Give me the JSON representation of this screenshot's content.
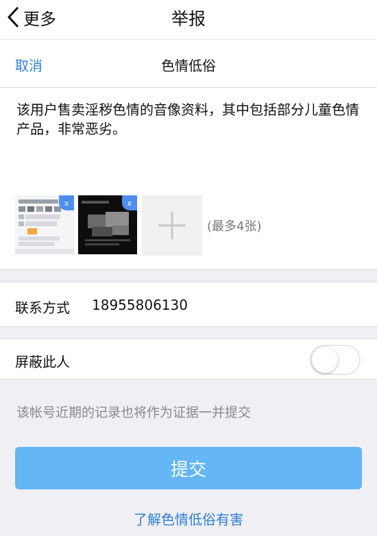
{
  "nav": {
    "back_label": "更多",
    "title": "举报"
  },
  "subbar": {
    "cancel_label": "取消",
    "category": "色情低俗"
  },
  "report": {
    "description": "该用户售卖淫秽色情的音像资料，其中包括部分儿童色情产品，非常恶劣。",
    "attachments": [
      {
        "icon": "screenshot-thumbnail-chat",
        "remove_label": "x"
      },
      {
        "icon": "screenshot-thumbnail-video",
        "remove_label": "x"
      }
    ],
    "add_icon": "plus-icon",
    "limit_text": "(最多4张)"
  },
  "contact": {
    "label": "联系方式",
    "value": "18955806130"
  },
  "block_user": {
    "label": "屏蔽此人",
    "enabled": false
  },
  "note": "该帐号近期的记录也将作为证据一并提交",
  "submit_label": "提交",
  "learn_more_label": "了解色情低俗有害",
  "colors": {
    "accent": "#2f7fd4",
    "submit_bg": "#64b6f5",
    "delete_badge": "#4f8ef0"
  }
}
